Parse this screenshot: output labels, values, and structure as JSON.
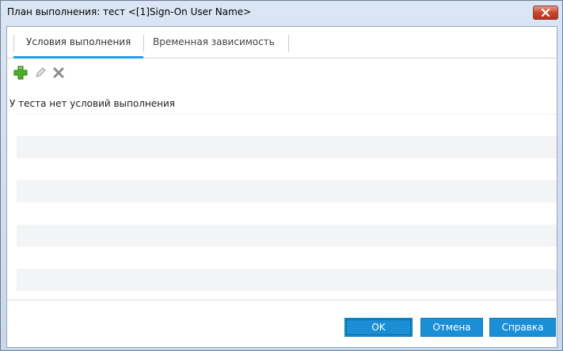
{
  "window": {
    "title": "План выполнения: тест <[1]Sign-On User Name>",
    "close_icon": "close-icon",
    "close_color": "#c8482f"
  },
  "tabs": [
    {
      "label": "Условия выполнения",
      "active": true
    },
    {
      "label": "Временная зависимость",
      "active": false
    }
  ],
  "accent_color": "#1ba1e2",
  "toolbar": {
    "add_icon": "plus-icon",
    "edit_icon": "pencil-icon",
    "delete_icon": "x-icon"
  },
  "list": {
    "empty_message": "У теста нет условий выполнения"
  },
  "footer": {
    "ok_label": "OK",
    "cancel_label": "Отмена",
    "help_label": "Справка",
    "button_color": "#1a8fd6"
  }
}
